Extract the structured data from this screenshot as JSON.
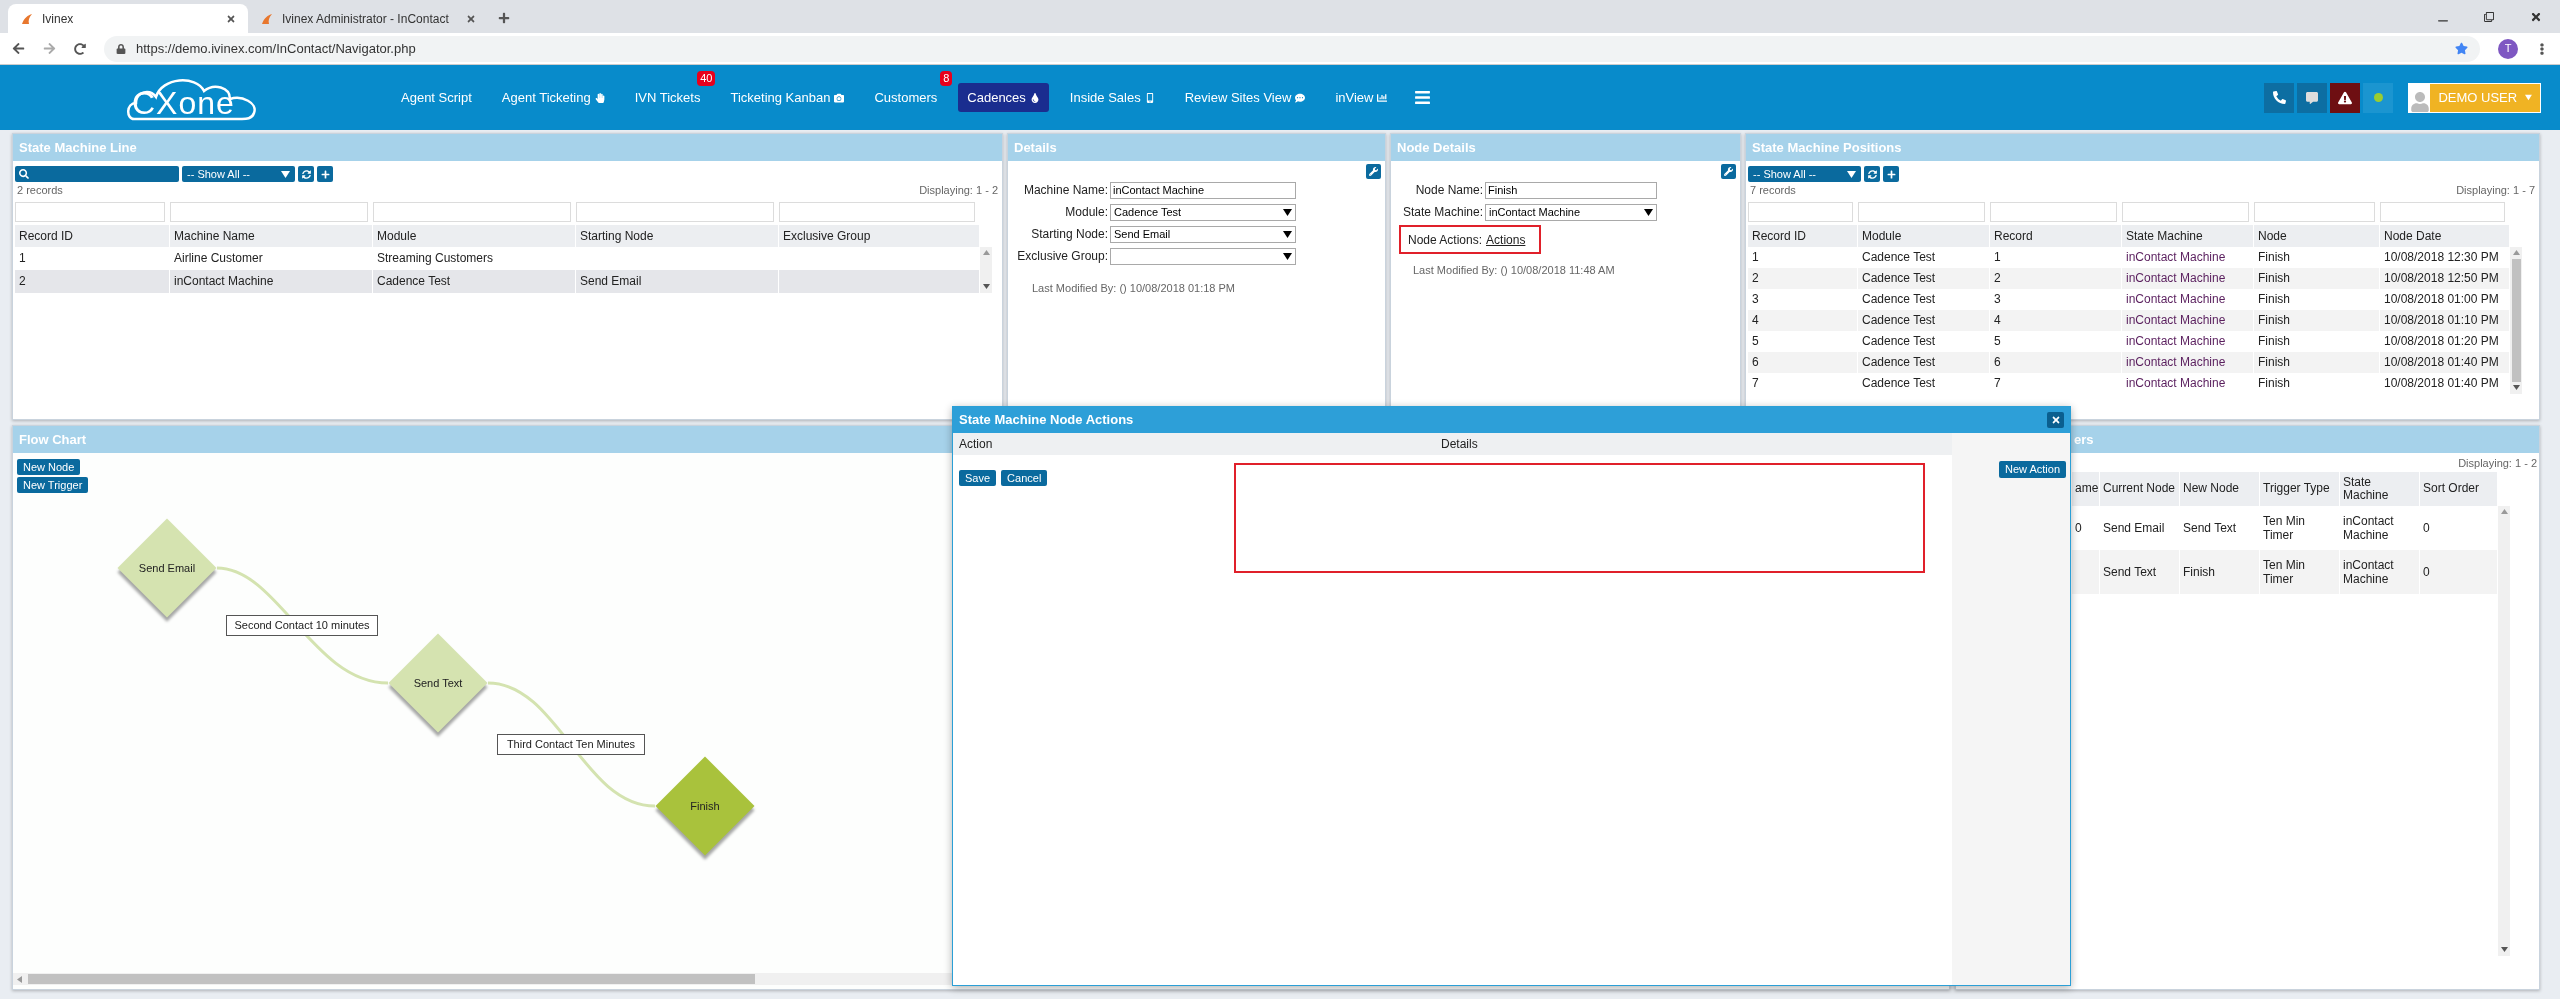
{
  "browser": {
    "tabs": [
      {
        "title": "Ivinex",
        "selected": true
      },
      {
        "title": "Ivinex Administrator - InContact",
        "selected": false
      }
    ],
    "url": "https://demo.ivinex.com/InContact/Navigator.php",
    "profile_initial": "T"
  },
  "navbar": {
    "logo": "CXone",
    "items": [
      {
        "label": "Agent Script",
        "selected": false
      },
      {
        "label": "Agent Ticketing",
        "selected": false
      },
      {
        "label": "IVN Tickets",
        "selected": false,
        "badge": "40"
      },
      {
        "label": "Ticketing Kanban",
        "selected": false
      },
      {
        "label": "Customers",
        "selected": false,
        "badge": "8"
      },
      {
        "label": "Cadences",
        "selected": true
      },
      {
        "label": "Inside Sales",
        "selected": false
      },
      {
        "label": "Review Sites View",
        "selected": false
      },
      {
        "label": "inView",
        "selected": false
      }
    ],
    "user": "DEMO USER"
  },
  "state_machine_line": {
    "title": "State Machine Line",
    "filter": "-- Show All --",
    "record_count": "2 records",
    "displaying": "Displaying: 1 - 2",
    "columns": [
      "Record ID",
      "Machine Name",
      "Module",
      "Starting Node",
      "Exclusive Group"
    ],
    "rows": [
      {
        "cells": [
          "1",
          "Airline Customer",
          "Streaming Customers"
        ],
        "selected": false
      },
      {
        "cells": [
          "2",
          "inContact Machine",
          "Cadence Test",
          "Send Email"
        ],
        "selected": true
      }
    ]
  },
  "details": {
    "title": "Details",
    "fields": [
      {
        "label": "Machine Name:",
        "value": "inContact Machine",
        "kind": "text"
      },
      {
        "label": "Module:",
        "value": "Cadence Test",
        "kind": "select"
      },
      {
        "label": "Starting Node:",
        "value": "Send Email",
        "kind": "select"
      },
      {
        "label": "Exclusive Group:",
        "kind": "select"
      }
    ],
    "last_modified": "Last Modified By: () 10/08/2018 01:18 PM"
  },
  "node_details": {
    "title": "Node Details",
    "fields": [
      {
        "label": "Node Name:",
        "value": "Finish",
        "kind": "text"
      },
      {
        "label": "State Machine:",
        "value": "inContact Machine",
        "kind": "select"
      }
    ],
    "node_actions": {
      "label": "Node Actions:",
      "link": "Actions",
      "highlighted": true
    },
    "last_modified": "Last Modified By: () 10/08/2018 11:48 AM"
  },
  "state_machine_positions": {
    "title": "State Machine Positions",
    "filter": "-- Show All --",
    "record_count": "7 records",
    "displaying": "Displaying: 1 - 7",
    "columns": [
      "Record ID",
      "Module",
      "Record",
      "State Machine",
      "Node",
      "Node Date"
    ],
    "rows": [
      {
        "cells": [
          "1",
          "Cadence Test",
          "1",
          "inContact Machine",
          "Finish",
          "10/08/2018 12:30 PM"
        ]
      },
      {
        "cells": [
          "2",
          "Cadence Test",
          "2",
          "inContact Machine",
          "Finish",
          "10/08/2018 12:50 PM"
        ]
      },
      {
        "cells": [
          "3",
          "Cadence Test",
          "3",
          "inContact Machine",
          "Finish",
          "10/08/2018 01:00 PM"
        ]
      },
      {
        "cells": [
          "4",
          "Cadence Test",
          "4",
          "inContact Machine",
          "Finish",
          "10/08/2018 01:10 PM"
        ]
      },
      {
        "cells": [
          "5",
          "Cadence Test",
          "5",
          "inContact Machine",
          "Finish",
          "10/08/2018 01:20 PM"
        ]
      },
      {
        "cells": [
          "6",
          "Cadence Test",
          "6",
          "inContact Machine",
          "Finish",
          "10/08/2018 01:40 PM"
        ]
      },
      {
        "cells": [
          "7",
          "Cadence Test",
          "7",
          "inContact Machine",
          "Finish",
          "10/08/2018 01:40 PM"
        ]
      }
    ]
  },
  "flow_chart": {
    "title": "Flow Chart",
    "buttons": [
      "New Node",
      "New Trigger"
    ],
    "nodes": [
      {
        "label": "Send Email",
        "selected": false
      },
      {
        "label": "Send Text",
        "selected": false
      },
      {
        "label": "Finish",
        "selected": true
      }
    ],
    "edges": [
      {
        "label": "Second Contact 10 minutes"
      },
      {
        "label": "Third Contact Ten Minutes"
      }
    ]
  },
  "triggers": {
    "title": "ers",
    "displaying": "Displaying: 1 - 2",
    "columns": [
      "ame",
      "Current Node",
      "New Node",
      "Trigger Type",
      "State Machine",
      "Sort Order"
    ],
    "rows": [
      {
        "cells": [
          "0",
          "Send Email",
          "Send Text",
          "Ten Min Timer",
          "inContact Machine",
          "0"
        ]
      },
      {
        "cells": [
          "",
          "Send Text",
          "Finish",
          "Ten Min Timer",
          "inContact Machine",
          "0"
        ]
      }
    ]
  },
  "modal": {
    "title": "State Machine Node Actions",
    "columns": [
      "Action",
      "Details"
    ],
    "buttons": [
      "Save",
      "Cancel"
    ],
    "new_action": "New Action",
    "highlighted": true
  }
}
